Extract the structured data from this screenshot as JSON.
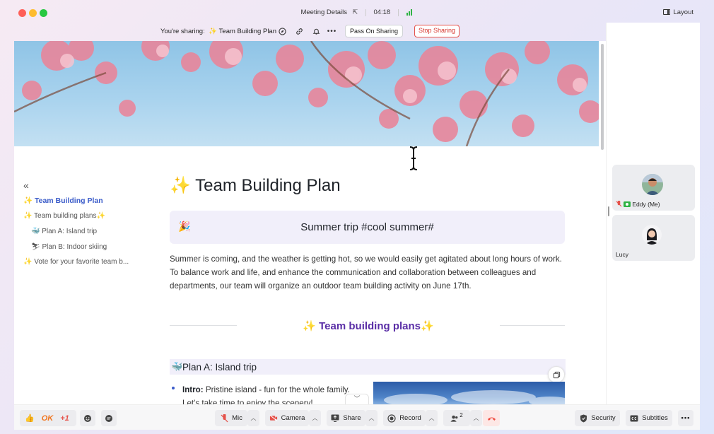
{
  "window": {
    "title": "Meeting Details",
    "timer": "04:18",
    "layout_label": "Layout"
  },
  "sharebar": {
    "label": "You're sharing:",
    "doc_name": "✨ Team Building Plan",
    "pass_label": "Pass On Sharing",
    "stop_label": "Stop Sharing"
  },
  "toc": {
    "items": [
      {
        "label": "✨ Team Building Plan"
      },
      {
        "label": "✨ Team building plans✨"
      },
      {
        "label": "🐳 Plan A: Island trip"
      },
      {
        "label": "⛷ Plan B: Indoor skiing"
      },
      {
        "label": "✨ Vote for your favorite team b..."
      }
    ]
  },
  "doc": {
    "title_emoji": "✨",
    "title": "Team Building Plan",
    "callout_emoji": "🎉",
    "callout_text": "Summer trip #cool summer#",
    "paragraph": "Summer is coming, and the weather is getting hot, so we would easily get agitated about long hours of work. To balance work and life, and enhance the communication and collaboration between colleagues and departments, our team will organize an outdoor team building activity on June 17th.",
    "section_title": "✨ Team building plans✨",
    "planA_emoji": "🐳",
    "planA_title": "Plan A: Island trip",
    "intro_label": "Intro:",
    "intro_text": " Pristine island - fun for the whole family. Let's take time to enjoy the scenery!"
  },
  "participants": [
    {
      "name": "Eddy (Me)"
    },
    {
      "name": "Lucy"
    }
  ],
  "toolbar": {
    "reactions": [
      "👍",
      "OK",
      "+1"
    ],
    "mic_label": "Mic",
    "camera_label": "Camera",
    "share_label": "Share",
    "record_label": "Record",
    "participants_count": "2",
    "security_label": "Security",
    "subtitles_label": "Subtitles"
  },
  "colors": {
    "accent": "#3b5cc9",
    "section_purple": "#5a2ea6",
    "stop_red": "#d7372f",
    "end_call_red": "#f04b3f"
  }
}
